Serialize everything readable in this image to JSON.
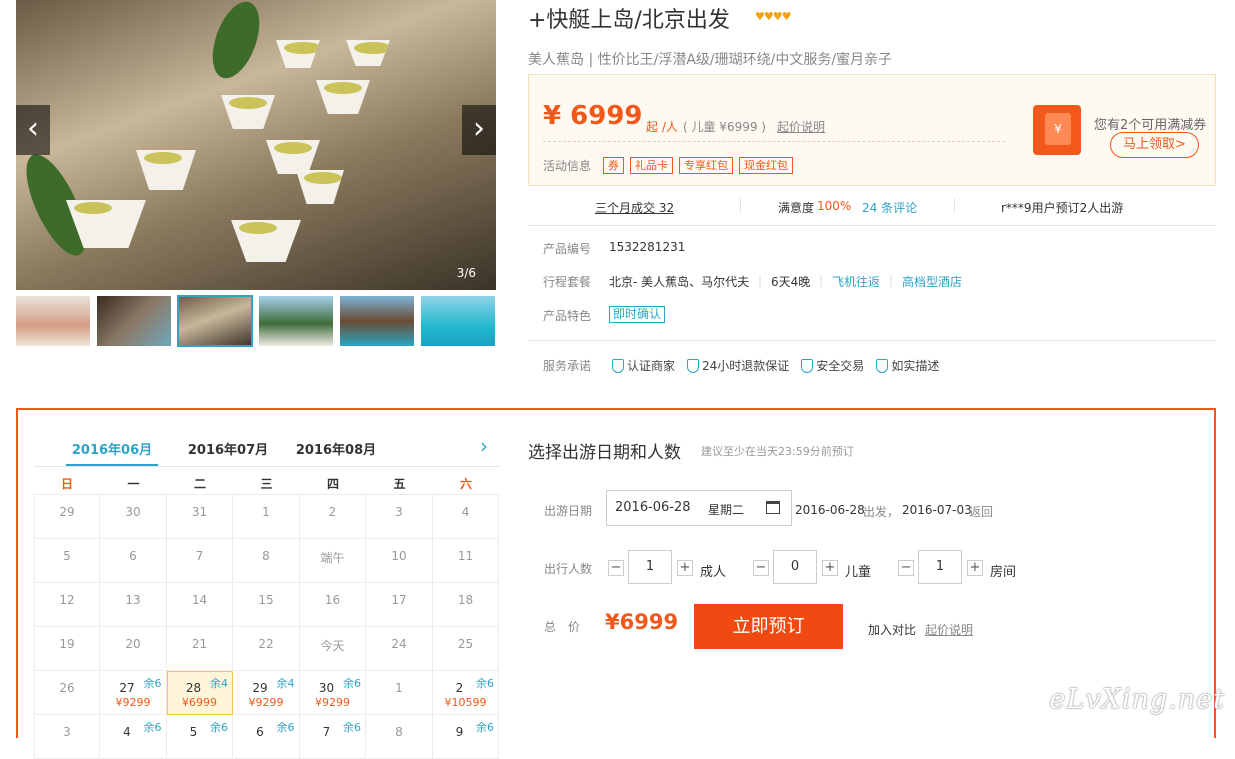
{
  "gallery": {
    "counter": "3/6",
    "prev_icon": "chevron-left-icon",
    "next_icon": "chevron-right-icon",
    "thumbs": [
      "thumb-1",
      "thumb-2",
      "thumb-3",
      "thumb-4",
      "thumb-5",
      "thumb-6"
    ],
    "selected_index": 2
  },
  "product": {
    "title": "+快艇上岛/北京出发",
    "stars": "♥♥♥♥",
    "subtitle": "美人蕉岛 | 性价比王/浮潜A级/珊瑚环绕/中文服务/蜜月亲子",
    "price": "¥ 6999",
    "price_unit": "起 /人",
    "child_price": "( 儿童 ¥6999 )",
    "price_note": "起价说明",
    "activity_label": "活动信息",
    "activity_tags": [
      "券",
      "礼品卡",
      "专享红包",
      "现金红包"
    ],
    "coupon_text": "您有2个可用满减券",
    "coupon_button": "马上领取>"
  },
  "stats": {
    "sold": "三个月成交 32",
    "satisfaction_label": "满意度",
    "satisfaction_value": "100%",
    "reviews": "24 条评论",
    "recent": "r***9用户预订2人出游"
  },
  "details": {
    "code_label": "产品编号",
    "code_value": "1532281231",
    "package_label": "行程套餐",
    "route": "北京- 美人蕉岛、马尔代夫",
    "duration": "6天4晚",
    "flight": "飞机往返",
    "hotel": "高档型酒店",
    "feature_label": "产品特色",
    "feature_tag": "即时确认",
    "service_label": "服务承诺",
    "services": [
      "认证商家",
      "24小时退款保证",
      "安全交易",
      "如实描述"
    ]
  },
  "calendar": {
    "months": [
      "2016年06月",
      "2016年07月",
      "2016年08月"
    ],
    "active_month": 0,
    "weekdays": [
      "日",
      "一",
      "二",
      "三",
      "四",
      "五",
      "六"
    ],
    "rows": [
      [
        {
          "d": "29"
        },
        {
          "d": "30"
        },
        {
          "d": "31"
        },
        {
          "d": "1"
        },
        {
          "d": "2"
        },
        {
          "d": "3"
        },
        {
          "d": "4"
        }
      ],
      [
        {
          "d": "5"
        },
        {
          "d": "6"
        },
        {
          "d": "7"
        },
        {
          "d": "8"
        },
        {
          "d": "端午"
        },
        {
          "d": "10"
        },
        {
          "d": "11"
        }
      ],
      [
        {
          "d": "12"
        },
        {
          "d": "13"
        },
        {
          "d": "14"
        },
        {
          "d": "15"
        },
        {
          "d": "16"
        },
        {
          "d": "17"
        },
        {
          "d": "18"
        }
      ],
      [
        {
          "d": "19"
        },
        {
          "d": "20"
        },
        {
          "d": "21"
        },
        {
          "d": "22"
        },
        {
          "d": "今天"
        },
        {
          "d": "24"
        },
        {
          "d": "25"
        }
      ],
      [
        {
          "d": "26"
        },
        {
          "d": "27",
          "r": "余6",
          "p": "¥9299"
        },
        {
          "d": "28",
          "r": "余4",
          "p": "¥6999",
          "sel": true
        },
        {
          "d": "29",
          "r": "余4",
          "p": "¥9299"
        },
        {
          "d": "30",
          "r": "余6",
          "p": "¥9299"
        },
        {
          "d": "1"
        },
        {
          "d": "2",
          "r": "余6",
          "p": "¥10599"
        }
      ],
      [
        {
          "d": "3"
        },
        {
          "d": "4",
          "r": "余6"
        },
        {
          "d": "5",
          "r": "余6"
        },
        {
          "d": "6",
          "r": "余6"
        },
        {
          "d": "7",
          "r": "余6"
        },
        {
          "d": "8"
        },
        {
          "d": "9",
          "r": "余6"
        }
      ]
    ]
  },
  "booking": {
    "heading": "选择出游日期和人数",
    "hint": "建议至少在当天23:59分前预订",
    "date_label": "出游日期",
    "date_value": "2016-06-28",
    "weekday": "星期二",
    "date_summary_start": "2016-06-28",
    "depart_word": "出发，",
    "date_summary_end": "2016-07-03",
    "return_word": "返回",
    "people_label": "出行人数",
    "adults": "1",
    "adult_word": "成人",
    "children": "0",
    "child_word": "儿童",
    "rooms": "1",
    "room_word": "房间",
    "total_label": "总　价",
    "total_value": "¥6999",
    "book_button": "立即预订",
    "compare": "加入对比",
    "price_note": "起价说明"
  },
  "watermark": "eLvXing.net",
  "colors": {
    "accent": "#f3581b",
    "link": "#2ea3c7",
    "gold": "#f1a20d"
  }
}
